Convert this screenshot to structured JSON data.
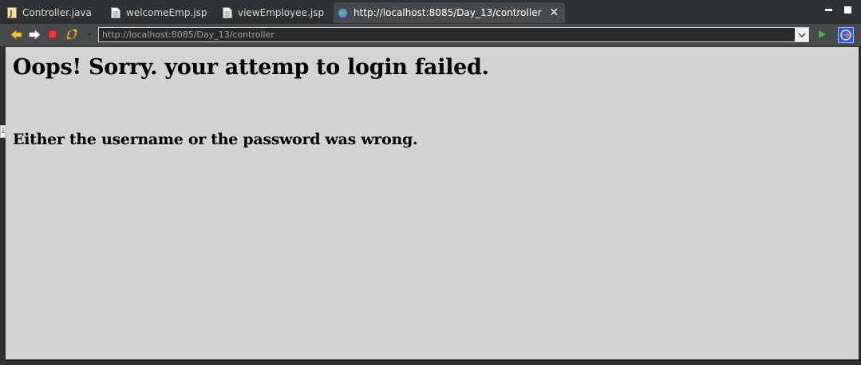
{
  "tabs": [
    {
      "label": "Controller.java",
      "icon": "java-file-icon",
      "active": false
    },
    {
      "label": "welcomeEmp.jsp",
      "icon": "jsp-file-icon",
      "active": false
    },
    {
      "label": "viewEmployee.jsp",
      "icon": "jsp-file-icon",
      "active": false
    },
    {
      "label": "http://localhost:8085/Day_13/controller",
      "icon": "globe-icon",
      "active": true
    }
  ],
  "tab_close": "✕",
  "toolbar": {
    "back": "back-arrow-icon",
    "forward": "forward-arrow-icon",
    "stop": "stop-icon",
    "refresh": "refresh-icon",
    "url": "http://localhost:8085/Day_13/controller",
    "go": "go-icon",
    "extra": "external-browser-icon"
  },
  "page": {
    "heading": "Oops! Sorry. your attemp to login failed.",
    "message": "Either the username or the password was wrong."
  },
  "side_marker": "1",
  "colors": {
    "content_bg": "#d3d3d3",
    "chrome_bg": "#2f3133",
    "toolbar_bg": "#48494b",
    "arrow_yellow": "#f5c542",
    "stop_red": "#e53935"
  }
}
